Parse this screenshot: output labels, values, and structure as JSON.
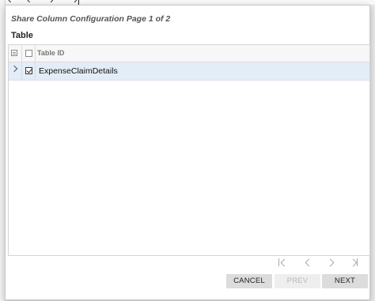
{
  "dialog": {
    "title": "Share Column Configuration Page 1 of 2",
    "section_title": "Table"
  },
  "grid": {
    "column_header": "Table ID",
    "header_checkbox_checked": false,
    "rows": [
      {
        "label": "ExpenseClaimDetails",
        "checked": true,
        "expandable": true
      }
    ]
  },
  "pager": {
    "first_icon": "first-page-icon",
    "prev_icon": "chevron-left-icon",
    "next_icon": "chevron-right-icon",
    "last_icon": "last-page-icon"
  },
  "buttons": {
    "cancel": "CANCEL",
    "prev": "PREV",
    "next": "NEXT"
  },
  "colors": {
    "selected_row": "#e3edf7",
    "button_bg": "#dcdcdc",
    "disabled_text": "#b8b8b8"
  }
}
